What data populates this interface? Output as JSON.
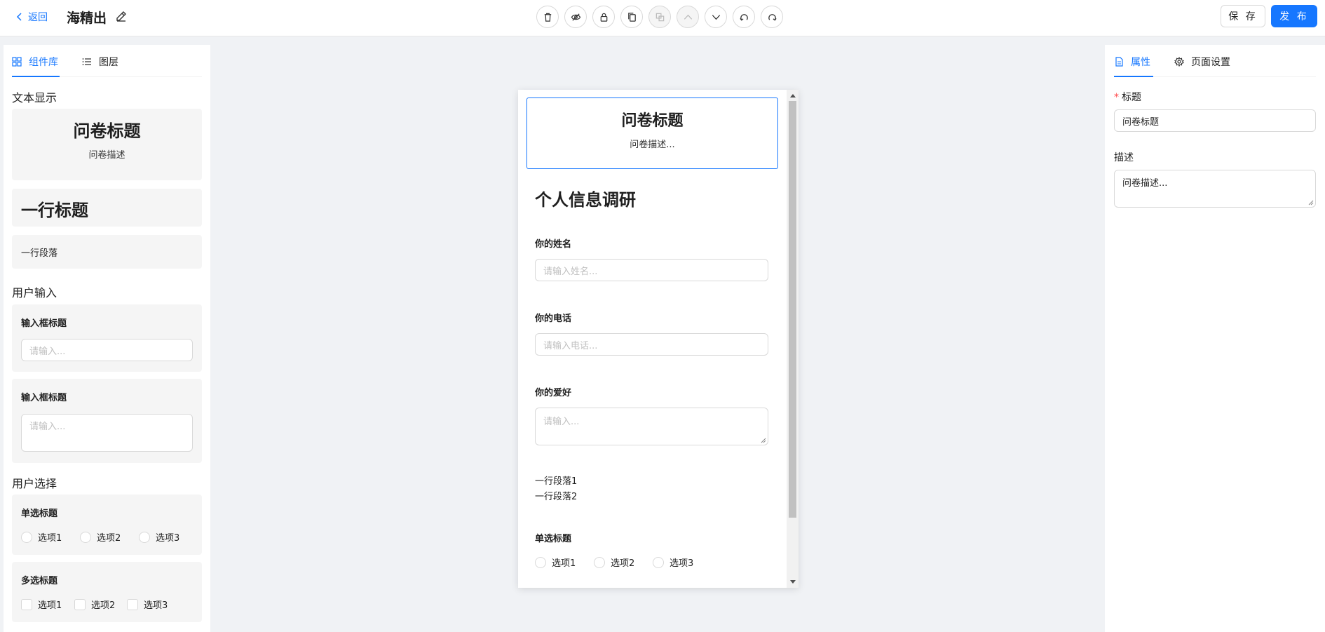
{
  "header": {
    "back_label": "返回",
    "app_title": "海精出",
    "save_label": "保 存",
    "publish_label": "发 布"
  },
  "left_panel": {
    "tabs": [
      {
        "label": "组件库",
        "icon": "grid-icon",
        "active": true
      },
      {
        "label": "图层",
        "icon": "list-icon",
        "active": false
      }
    ],
    "groups": [
      {
        "title": "文本显示"
      },
      {
        "title": "用户输入"
      },
      {
        "title": "用户选择"
      }
    ],
    "text_components": {
      "title_card": {
        "title": "问卷标题",
        "desc": "问卷描述"
      },
      "heading_card": {
        "text": "一行标题"
      },
      "paragraph_card": {
        "text": "一行段落"
      }
    },
    "input_components": {
      "input_card": {
        "label": "输入框标题",
        "placeholder": "请输入..."
      },
      "textarea_card": {
        "label": "输入框标题",
        "placeholder": "请输入..."
      }
    },
    "choice_components": {
      "radio_card": {
        "label": "单选标题",
        "options": [
          "选项1",
          "选项2",
          "选项3"
        ]
      },
      "checkbox_card": {
        "label": "多选标题",
        "options": [
          "选项1",
          "选项2",
          "选项3"
        ]
      }
    }
  },
  "canvas": {
    "title_block": {
      "title": "问卷标题",
      "desc": "问卷描述..."
    },
    "heading": "个人信息调研",
    "name_field": {
      "label": "你的姓名",
      "placeholder": "请输入姓名..."
    },
    "phone_field": {
      "label": "你的电话",
      "placeholder": "请输入电话..."
    },
    "hobby_field": {
      "label": "你的爱好",
      "placeholder": "请输入..."
    },
    "paragraph_lines": [
      "一行段落1",
      "一行段落2"
    ],
    "radio_block": {
      "label": "单选标题",
      "options": [
        "选项1",
        "选项2",
        "选项3"
      ]
    }
  },
  "right_panel": {
    "tabs": [
      {
        "label": "属性",
        "icon": "file-icon",
        "active": true
      },
      {
        "label": "页面设置",
        "icon": "gear-icon",
        "active": false
      }
    ],
    "title_field": {
      "required_mark": "*",
      "label": "标题",
      "value": "问卷标题"
    },
    "desc_field": {
      "label": "描述",
      "value": "问卷描述..."
    }
  },
  "colors": {
    "accent": "#1677ff",
    "background": "#f0f2f5",
    "card": "#f5f5f5",
    "border": "#d9d9d9"
  }
}
